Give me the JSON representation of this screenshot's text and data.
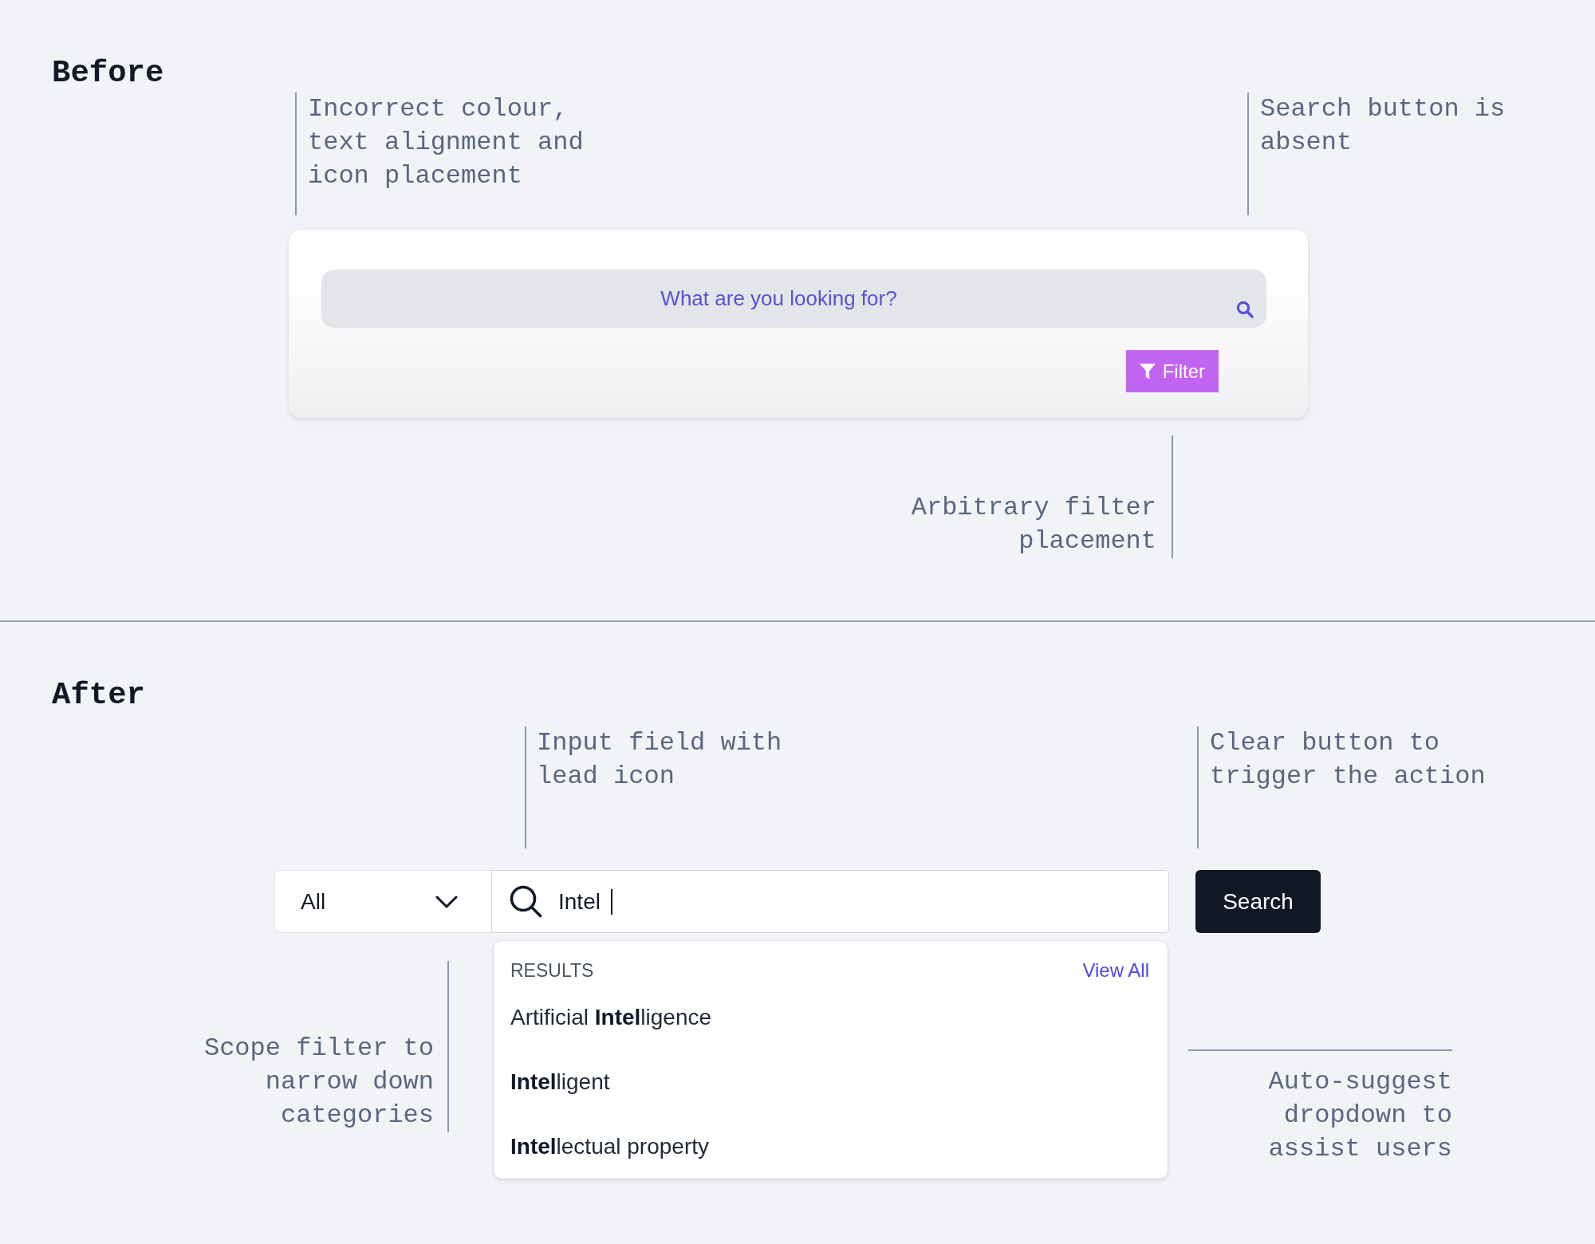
{
  "before": {
    "title": "Before",
    "callouts": [
      {
        "text": "Incorrect colour, text alignment and icon placement"
      },
      {
        "text": "Search button is absent"
      },
      {
        "text": "Arbitrary filter placement"
      }
    ],
    "search_field": {
      "placeholder": "What are you looking for?"
    },
    "filter_button": {
      "label": "Filter"
    }
  },
  "after": {
    "title": "After",
    "callouts": [
      {
        "text": "Input field with lead icon"
      },
      {
        "text": "Clear button to trigger the action"
      },
      {
        "text": "Scope filter to narrow down categories"
      },
      {
        "text": "Auto-suggest dropdown to assist users"
      }
    ],
    "scope_select": {
      "value": "All"
    },
    "search_field": {
      "value": "Intel"
    },
    "search_button": {
      "label": "Search"
    },
    "suggestions": {
      "heading": "RESULTS",
      "view_all": "View All",
      "items": [
        {
          "text": "Artificial **Intel**ligence",
          "selected": false
        },
        {
          "text": "**Intel**ligent",
          "selected": false
        },
        {
          "text": "**Intel**lectual property",
          "selected": false
        }
      ]
    }
  }
}
